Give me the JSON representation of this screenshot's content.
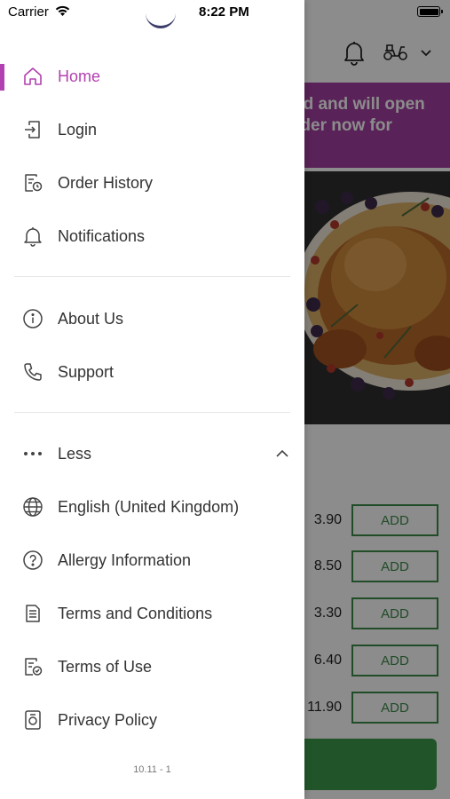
{
  "status_bar": {
    "carrier": "Carrier",
    "time": "8:22 PM"
  },
  "drawer": {
    "primary_items": [
      {
        "label": "Home",
        "icon": "home-icon",
        "active": true
      },
      {
        "label": "Login",
        "icon": "login-icon"
      },
      {
        "label": "Order History",
        "icon": "order-history-icon"
      },
      {
        "label": "Notifications",
        "icon": "bell-icon"
      }
    ],
    "info_items": [
      {
        "label": "About Us",
        "icon": "info-icon"
      },
      {
        "label": "Support",
        "icon": "phone-icon"
      }
    ],
    "less_label": "Less",
    "more_items": [
      {
        "label": "English (United Kingdom)",
        "icon": "globe-icon"
      },
      {
        "label": "Allergy Information",
        "icon": "question-icon"
      },
      {
        "label": "Terms and Conditions",
        "icon": "document-icon"
      },
      {
        "label": "Terms of Use",
        "icon": "document-check-icon"
      },
      {
        "label": "Privacy Policy",
        "icon": "privacy-icon"
      }
    ],
    "version": "10.11 - 1"
  },
  "background": {
    "banner_lines": [
      "ed and will open",
      "rder now for"
    ],
    "menu_items": [
      {
        "price": "3.90",
        "button": "ADD"
      },
      {
        "price": "8.50",
        "button": "ADD"
      },
      {
        "price": "3.30",
        "button": "ADD"
      },
      {
        "price": "6.40",
        "button": "ADD"
      },
      {
        "price": "11.90",
        "button": "ADD"
      }
    ]
  },
  "colors": {
    "accent": "#b340b0",
    "banner": "#a23ea0",
    "add_green": "#3d8a49",
    "cta_green": "#3c9a4b"
  }
}
